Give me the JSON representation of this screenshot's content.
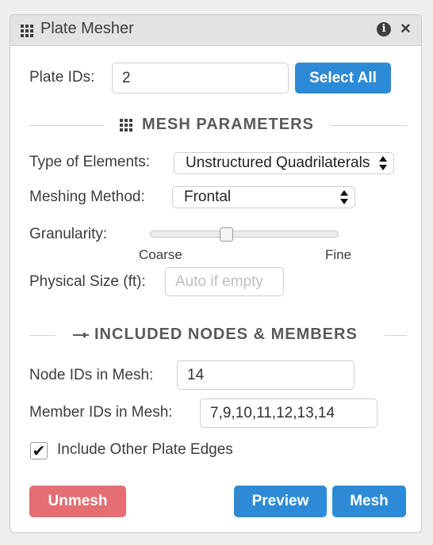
{
  "window": {
    "title": "Plate Mesher",
    "icon": "grid-icon",
    "info_icon": "info-icon",
    "close_icon": "close-icon"
  },
  "plate_ids": {
    "label": "Plate IDs:",
    "value": "2",
    "select_all": "Select All"
  },
  "mesh_parameters": {
    "heading": "MESH PARAMETERS",
    "type_label": "Type of Elements:",
    "type_value": "Unstructured Quadrilaterals",
    "method_label": "Meshing Method:",
    "method_value": "Frontal",
    "granularity_label": "Granularity:",
    "granularity_level": 0.4,
    "coarse_label": "Coarse",
    "fine_label": "Fine",
    "physical_size_label": "Physical Size (ft):",
    "physical_size_placeholder": "Auto if empty"
  },
  "included": {
    "heading": "INCLUDED NODES & MEMBERS",
    "node_label": "Node IDs in Mesh:",
    "node_value": "14",
    "member_label": "Member IDs in Mesh:",
    "member_value": "7,9,10,11,12,13,14",
    "include_edges_label": "Include Other Plate Edges",
    "include_edges_checked": true
  },
  "actions": {
    "unmesh": "Unmesh",
    "preview": "Preview",
    "mesh": "Mesh"
  },
  "colors": {
    "primary": "#2d8ad6",
    "danger": "#e46e72",
    "header_bg": "#e3e3e3"
  }
}
